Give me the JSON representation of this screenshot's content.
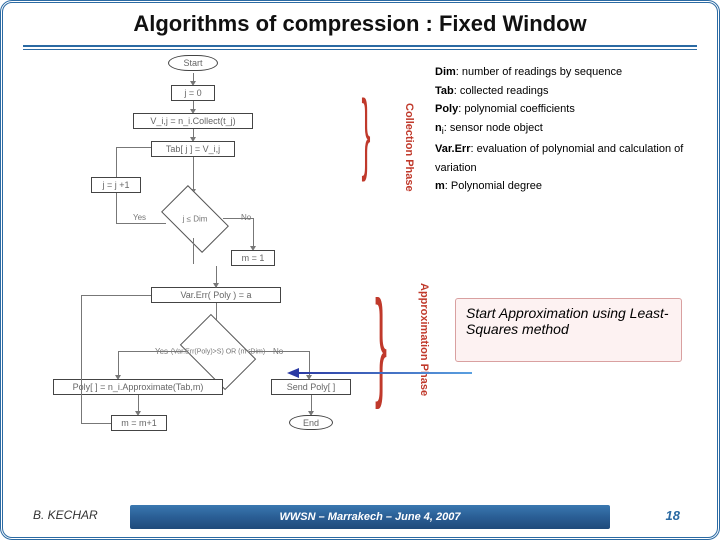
{
  "title": "Algorithms of compression : Fixed Window",
  "flowchart": {
    "start": "Start",
    "init_j": "j = 0",
    "collect": "V_i,j = n_i.Collect(t_j)",
    "store": "Tab[ j ] = V_i,j",
    "inc_j": "j = j +1",
    "cond1": "j ≤ Dim",
    "yes": "Yes",
    "no": "No",
    "init_m": "m = 1",
    "varerr": "Var.Err(  Poly  ) = a",
    "cond2": "(Var.Err(Poly)>S)\nOR (m<Dim)",
    "approx": "Poly[ ] = n_i.Approximate(Tab,m)",
    "inc_m": "m = m+1",
    "send": "Send Poly[ ]",
    "end": "End"
  },
  "phases": {
    "collection": "Collection Phase",
    "approximation": "Approximation Phase"
  },
  "legend": {
    "dim_k": "Dim",
    "dim_v": ": number of readings by sequence",
    "tab_k": "Tab",
    "tab_v": ": collected readings",
    "poly_k": "Poly",
    "poly_v": ": polynomial coefficients",
    "ni_k": "n",
    "ni_sub": "i",
    "ni_v": ": sensor node object",
    "var_k": "Var.Err",
    "var_v": ": evaluation of polynomial and calculation of variation",
    "m_k": "m",
    "m_v": ": Polynomial degree"
  },
  "approx_callout": "Start Approximation using Least-Squares method",
  "footer": {
    "author": "B. KECHAR",
    "conference": "WWSN – Marrakech – June 4, 2007",
    "page": "18"
  }
}
